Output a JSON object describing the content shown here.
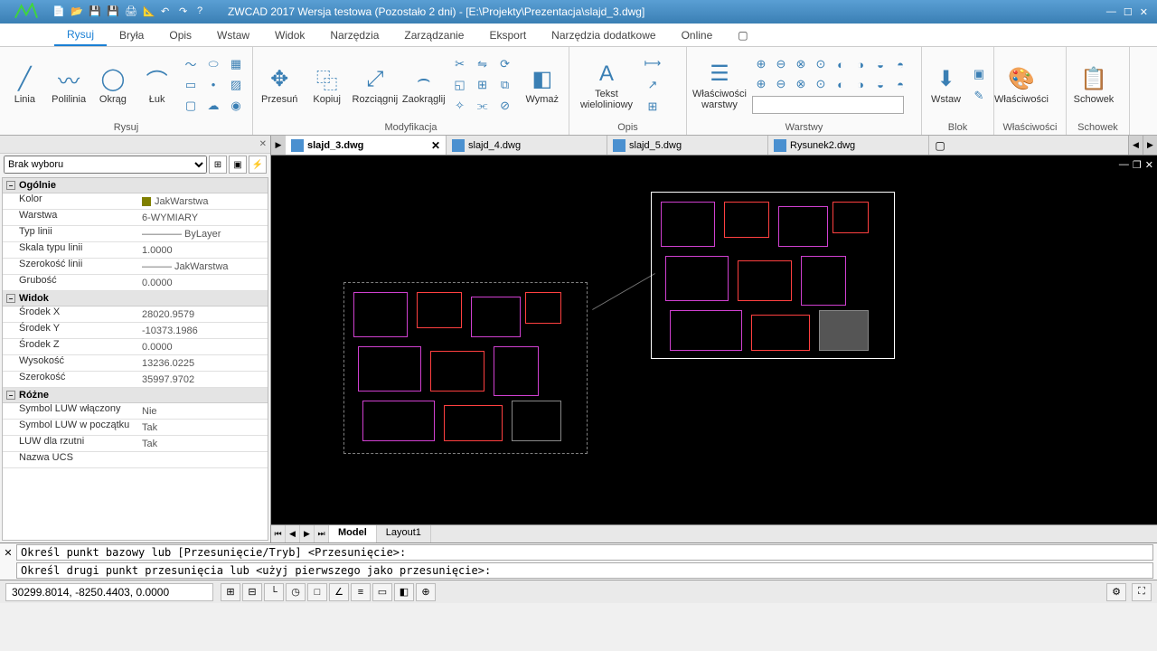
{
  "app": {
    "title": "ZWCAD 2017 Wersja testowa (Pozostało 2 dni) - [E:\\Projekty\\Prezentacja\\slajd_3.dwg]"
  },
  "ribbon_tabs": [
    "Rysuj",
    "Bryła",
    "Opis",
    "Wstaw",
    "Widok",
    "Narzędzia",
    "Zarządzanie",
    "Eksport",
    "Narzędzia dodatkowe",
    "Online"
  ],
  "active_ribbon_tab": "Rysuj",
  "ribbon_groups": {
    "draw": {
      "label": "Rysuj",
      "btns": {
        "line": "Linia",
        "polyline": "Polilinia",
        "circle": "Okrąg",
        "arc": "Łuk"
      }
    },
    "modify": {
      "label": "Modyfikacja",
      "btns": {
        "move": "Przesuń",
        "copy": "Kopiuj",
        "stretch": "Rozciągnij",
        "fillet": "Zaokrąglij",
        "erase": "Wymaż"
      }
    },
    "annot": {
      "label": "Opis",
      "btns": {
        "mtext1": "Tekst",
        "mtext2": "wieloliniowy"
      }
    },
    "layers": {
      "label": "Warstwy",
      "btns": {
        "props1": "Właściwości",
        "props2": "warstwy"
      }
    },
    "block": {
      "label": "Blok",
      "btns": {
        "insert": "Wstaw"
      }
    },
    "props": {
      "label": "Właściwości"
    },
    "clip": {
      "label": "Schowek"
    }
  },
  "properties_panel": {
    "selector": "Brak wyboru",
    "cat_general": "Ogólnie",
    "cat_view": "Widok",
    "cat_misc": "Różne",
    "rows": {
      "color": {
        "k": "Kolor",
        "v": "JakWarstwa",
        "swatch": "#808000"
      },
      "layer": {
        "k": "Warstwa",
        "v": "6-WYMIARY"
      },
      "linetype": {
        "k": "Typ linii",
        "v": "———— ByLayer"
      },
      "ltscale": {
        "k": "Skala typu linii",
        "v": "1.0000"
      },
      "lineweight": {
        "k": "Szerokość linii",
        "v": "——— JakWarstwa"
      },
      "thickness": {
        "k": "Grubość",
        "v": "0.0000"
      },
      "centerx": {
        "k": "Środek X",
        "v": "28020.9579"
      },
      "centery": {
        "k": "Środek Y",
        "v": "-10373.1986"
      },
      "centerz": {
        "k": "Środek Z",
        "v": "0.0000"
      },
      "height": {
        "k": "Wysokość",
        "v": "13236.0225"
      },
      "width": {
        "k": "Szerokość",
        "v": "35997.9702"
      },
      "ucsicon_on": {
        "k": "Symbol LUW włączony",
        "v": "Nie"
      },
      "ucsicon_origin": {
        "k": "Symbol LUW w początku",
        "v": "Tak"
      },
      "ucs_vp": {
        "k": "LUW dla rzutni",
        "v": "Tak"
      },
      "ucs_name": {
        "k": "Nazwa UCS",
        "v": ""
      }
    }
  },
  "doc_tabs": [
    "slajd_3.dwg",
    "slajd_4.dwg",
    "slajd_5.dwg",
    "Rysunek2.dwg"
  ],
  "active_doc": "slajd_3.dwg",
  "layout_tabs": [
    "Model",
    "Layout1"
  ],
  "active_layout": "Model",
  "command": {
    "history": "Określ punkt bazowy lub [Przesunięcie/Tryb] <Przesunięcie>:",
    "prompt": "Określ drugi punkt przesunięcia lub <użyj pierwszego jako przesunięcie>: "
  },
  "status": {
    "coords": "30299.8014, -8250.4403, 0.0000"
  }
}
